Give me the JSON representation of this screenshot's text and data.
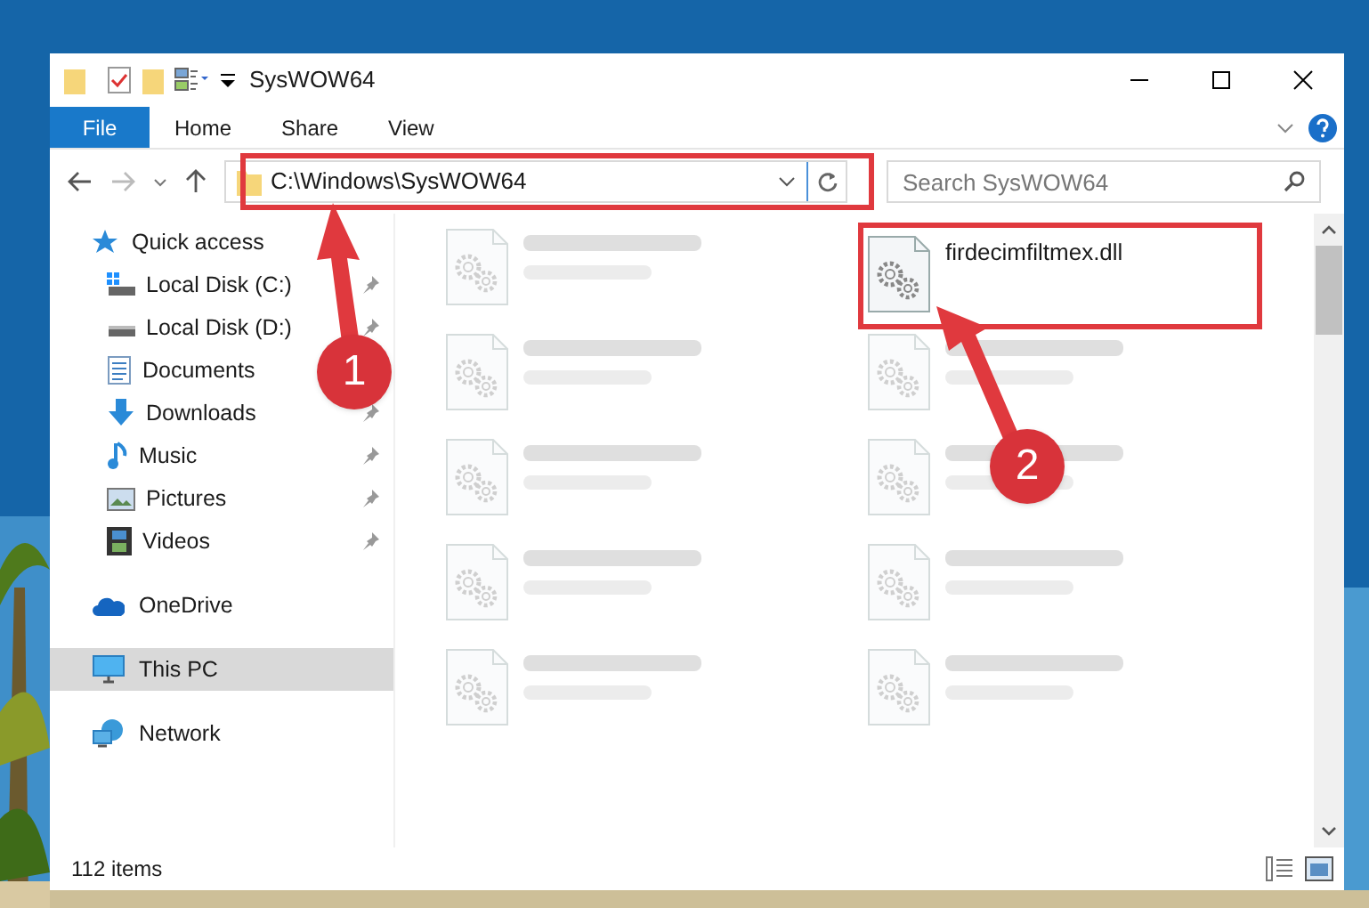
{
  "window": {
    "title": "SysWOW64"
  },
  "ribbon_tabs": [
    {
      "label": "File",
      "kind": "file"
    },
    {
      "label": "Home",
      "kind": "tab"
    },
    {
      "label": "Share",
      "kind": "tab"
    },
    {
      "label": "View",
      "kind": "tab"
    }
  ],
  "address": {
    "path": "C:\\Windows\\SysWOW64"
  },
  "search": {
    "placeholder": "Search SysWOW64"
  },
  "sidebar": {
    "items": [
      {
        "label": "Quick access",
        "kind": "star",
        "selected": false,
        "children": [
          {
            "label": "Local Disk (C:)",
            "kind": "windrive",
            "pinned": true
          },
          {
            "label": "Local Disk (D:)",
            "kind": "drive",
            "pinned": true
          },
          {
            "label": "Documents",
            "kind": "document",
            "pinned": false
          },
          {
            "label": "Downloads",
            "kind": "download",
            "pinned": true
          },
          {
            "label": "Music",
            "kind": "music",
            "pinned": true
          },
          {
            "label": "Pictures",
            "kind": "picture",
            "pinned": true
          },
          {
            "label": "Videos",
            "kind": "video",
            "pinned": true
          }
        ]
      },
      {
        "label": "OneDrive",
        "kind": "cloud",
        "selected": false
      },
      {
        "label": "This PC",
        "kind": "pc",
        "selected": true
      },
      {
        "label": "Network",
        "kind": "network",
        "selected": false
      }
    ]
  },
  "files": [
    {
      "faded": true
    },
    {
      "name": "firdecimfiltmex.dll",
      "faded": false
    },
    {
      "faded": true
    },
    {
      "faded": true
    },
    {
      "faded": true
    },
    {
      "faded": true
    },
    {
      "faded": true
    },
    {
      "faded": true
    },
    {
      "faded": true
    },
    {
      "faded": true
    }
  ],
  "status_bar": {
    "count": "112 items"
  },
  "annotations": [
    {
      "number": "1"
    },
    {
      "number": "2"
    }
  ]
}
